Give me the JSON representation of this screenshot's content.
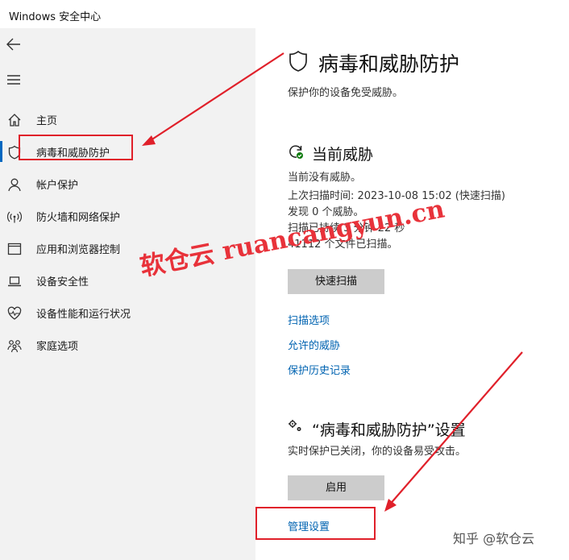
{
  "window": {
    "title": "Windows 安全中心"
  },
  "sidebar": {
    "items": [
      {
        "label": "主页",
        "icon": "home-icon"
      },
      {
        "label": "病毒和威胁防护",
        "icon": "shield-icon"
      },
      {
        "label": "帐户保护",
        "icon": "person-icon"
      },
      {
        "label": "防火墙和网络保护",
        "icon": "wifi-signal-icon"
      },
      {
        "label": "应用和浏览器控制",
        "icon": "app-window-icon"
      },
      {
        "label": "设备安全性",
        "icon": "laptop-icon"
      },
      {
        "label": "设备性能和运行状况",
        "icon": "heart-pulse-icon"
      },
      {
        "label": "家庭选项",
        "icon": "family-icon"
      }
    ]
  },
  "main": {
    "title": "病毒和威胁防护",
    "subtitle": "保护你的设备免受威胁。",
    "threats": {
      "heading": "当前威胁",
      "lines": [
        "当前没有威胁。",
        "上次扫描时间: 2023-10-08 15:02 (快速扫描)",
        "发现 0 个威胁。",
        "扫描已持续 3 分钟 22 秒",
        "41112 个文件已扫描。"
      ],
      "quick_scan_label": "快速扫描",
      "links": [
        "扫描选项",
        "允许的威胁",
        "保护历史记录"
      ]
    },
    "settings": {
      "heading": "“病毒和威胁防护”设置",
      "status": "实时保护已关闭，你的设备易受攻击。",
      "enable_label": "启用",
      "manage_label": "管理设置"
    }
  },
  "overlay": {
    "watermark": "软仓云 ruancangyun.cn",
    "zhihu": "知乎 @软仓云",
    "annotation_color": "#e0202a"
  }
}
